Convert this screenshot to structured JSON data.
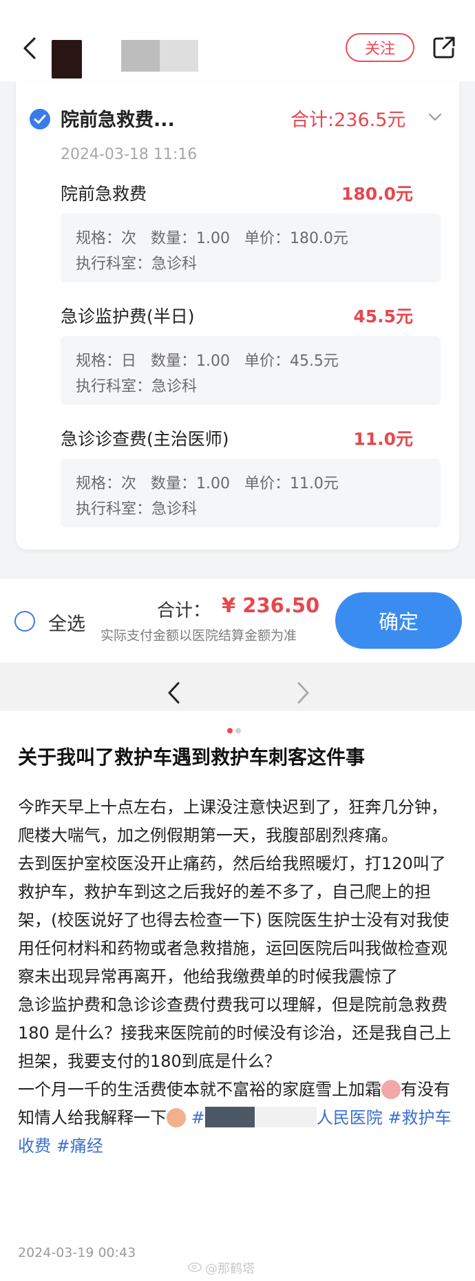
{
  "nav": {
    "follow_label": "关注"
  },
  "bill": {
    "group_title": "院前急救费...",
    "group_total": "合计:236.5元",
    "group_time": "2024-03-18 11:16",
    "items": [
      {
        "name": "院前急救费",
        "price": "180.0元",
        "line1": "规格：次   数量：1.00   单价：180.0元",
        "line2": "执行科室：急诊科"
      },
      {
        "name": "急诊监护费(半日)",
        "price": "45.5元",
        "line1": "规格：日   数量：1.00   单价：45.5元",
        "line2": "执行科室：急诊科"
      },
      {
        "name": "急诊诊查费(主治医师)",
        "price": "11.0元",
        "line1": "规格：次   数量：1.00   单价：11.0元",
        "line2": "执行科室：急诊科"
      }
    ]
  },
  "paybar": {
    "select_all": "全选",
    "total_label": "合计：",
    "total_amount": "¥ 236.50",
    "note": "实际支付金额以医院结算金额为准",
    "confirm": "确定"
  },
  "post": {
    "title": "关于我叫了救护车遇到救护车刺客这件事",
    "p1": "今昨天早上十点左右，上课没注意快迟到了，狂奔几分钟，爬楼大喘气，加之例假期第一天，我腹部剧烈疼痛。",
    "p2": "去到医护室校医没开止痛药，然后给我照暖灯，打120叫了救护车，救护车到这之后我好的差不多了，自己爬上的担架，(校医说好了也得去检查一下) 医院医生护士没有对我使用任何材料和药物或者急救措施，运回医院后叫我做检查观察未出现异常再离开，他给我缴费单的时候我震惊了",
    "p3": "急诊监护费和急诊诊查费付费我可以理解，但是院前急救费 180 是什么？接我来医院前的时候没有诊治，还是我自己上担架，我要支付的180到底是什么？",
    "p4a": "一个月一千的生活费使本就不富裕的家庭雪上加霜",
    "p4b": "有没有知情人给我解释一下",
    "tag1_prefix": "#",
    "tag1_suffix": "人民医院",
    "tag2": "#救护车收费",
    "tag3": "#痛经",
    "time": "2024-03-19 00:43",
    "watermark": "@那鹤塔"
  },
  "colors": {
    "accent_red": "#e6474e",
    "primary_blue": "#3b8cf0",
    "tag_blue": "#3b6fd0"
  }
}
